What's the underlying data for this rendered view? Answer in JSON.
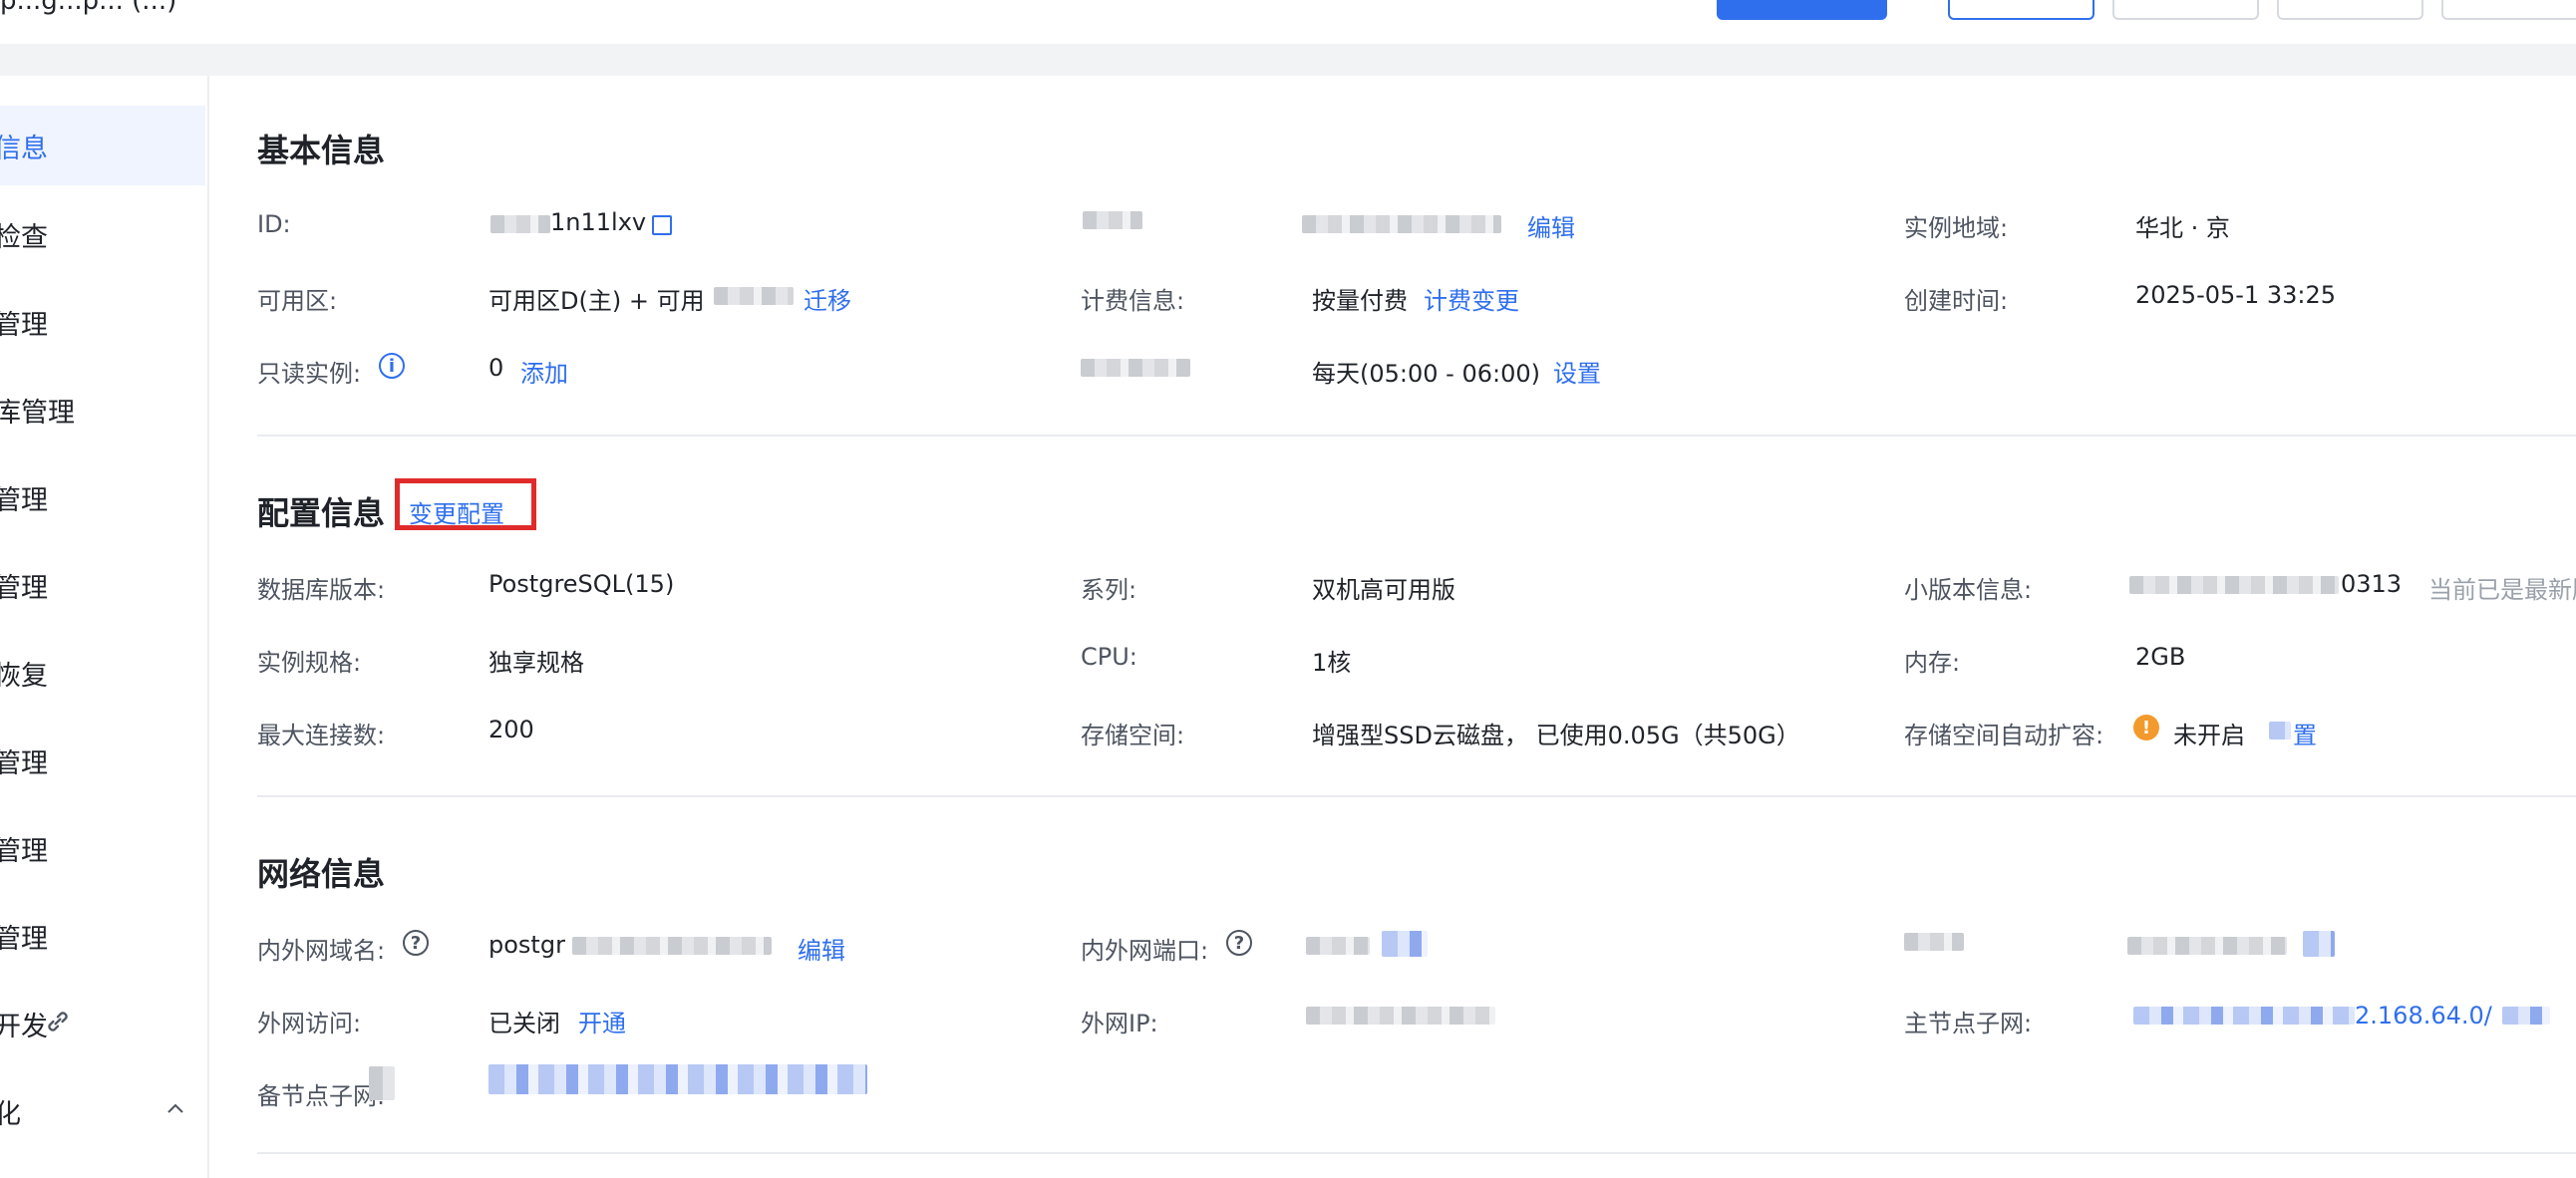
{
  "header": {
    "title": "p...g...p... (...)"
  },
  "sidebar": {
    "items": [
      {
        "label": "信息"
      },
      {
        "label": "检查"
      },
      {
        "label": "管理"
      },
      {
        "label": "库管理"
      },
      {
        "label": "管理"
      },
      {
        "label": "管理"
      },
      {
        "label": "恢复"
      },
      {
        "label": "管理"
      },
      {
        "label": "管理"
      },
      {
        "label": "管理"
      },
      {
        "label": "开发"
      },
      {
        "label": "化"
      }
    ]
  },
  "basic": {
    "title": "基本信息",
    "id_label": "ID:",
    "id_value": "1n11lxv",
    "edit_link": "编辑",
    "region_label": "实例地域:",
    "region_value": "华北 · 京",
    "zone_label": "可用区:",
    "zone_value": "可用区D(主) + 可用",
    "zone_link": "迁移",
    "billing_label": "计费信息:",
    "billing_value": "按量付费",
    "billing_link": "计费变更",
    "created_label": "创建时间:",
    "created_value": "2025-05-1 33:25",
    "readonly_label": "只读实例:",
    "readonly_value": "0",
    "readonly_link": "添加",
    "maint_value": "每天(05:00 - 06:00)",
    "maint_link": "设置"
  },
  "config": {
    "title": "配置信息",
    "change_link": "变更配置",
    "db_version_label": "数据库版本:",
    "db_version_value": "PostgreSQL(15)",
    "series_label": "系列:",
    "series_value": "双机高可用版",
    "minor_label": "小版本信息:",
    "minor_value": "0313",
    "minor_note": "当前已是最新版",
    "spec_label": "实例规格:",
    "spec_value": "独享规格",
    "cpu_label": "CPU:",
    "cpu_value": "1核",
    "mem_label": "内存:",
    "mem_value": "2GB",
    "maxconn_label": "最大连接数:",
    "maxconn_value": "200",
    "storage_label": "存储空间:",
    "storage_value": "增强型SSD云磁盘， 已使用0.05G（共50G）",
    "autoexpand_label": "存储空间自动扩容:",
    "autoexpand_value": "未开启",
    "autoexpand_link": "置"
  },
  "network": {
    "title": "网络信息",
    "domain_label": "内外网域名:",
    "domain_value": "postgr",
    "domain_link": "编辑",
    "port_label": "内外网端口:",
    "public_access_label": "外网访问:",
    "public_access_value": "已关闭",
    "public_access_link": "开通",
    "public_ip_label": "外网IP:",
    "master_subnet_label": "主节点子网:",
    "master_subnet_value": "2.168.64.0/",
    "standby_subnet_label": "备节点子网:"
  }
}
